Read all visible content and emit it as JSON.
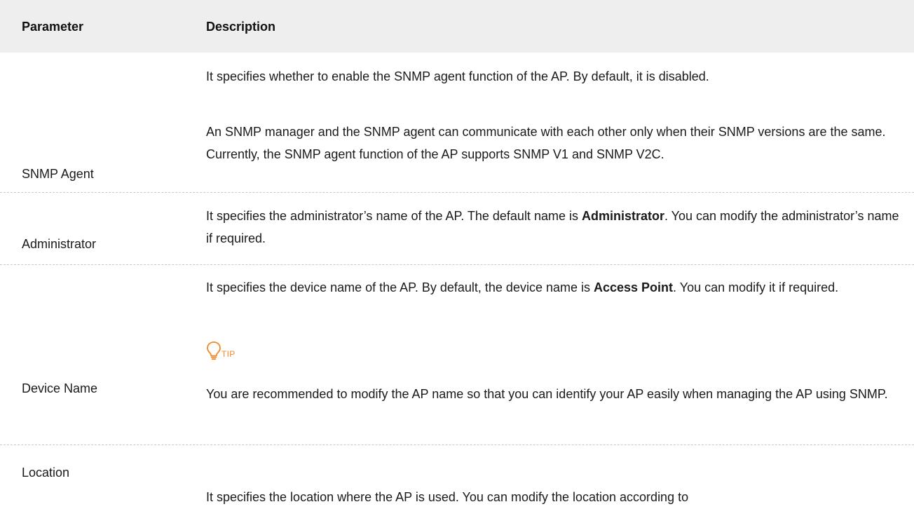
{
  "table": {
    "header": {
      "parameter": "Parameter",
      "description": "Description"
    },
    "rows": [
      {
        "parameter": "SNMP Agent",
        "paragraphs": [
          "It specifies whether to enable the SNMP agent function of the AP. By default, it is disabled.",
          "An SNMP manager and the SNMP agent can communicate with each other only when their SNMP versions are the same. Currently, the SNMP agent function of the AP supports SNMP V1 and SNMP V2C."
        ]
      },
      {
        "parameter": "Administrator",
        "text_before": "It specifies the administrator’s name of the AP. The default name is ",
        "bold": "Administrator",
        "text_after": ". You can modify the administrator’s name if required."
      },
      {
        "parameter": "Device Name",
        "text_before": "It specifies the device name of the AP. By default, the device name is ",
        "bold": "Access Point",
        "text_after": ". You can modify it if required.",
        "tip_label": "TIP",
        "tip_text": "You are recommended to modify the AP name so that you can identify your AP easily when managing the AP using SNMP."
      },
      {
        "parameter": "Location",
        "description": "It specifies the location where the AP is used. You can modify the location according to"
      }
    ]
  },
  "colors": {
    "header_background": "#eeeeee",
    "tip_accent": "#f08a2c",
    "divider": "#c9c9c9"
  },
  "icons": {
    "tip": "lightbulb-icon"
  }
}
